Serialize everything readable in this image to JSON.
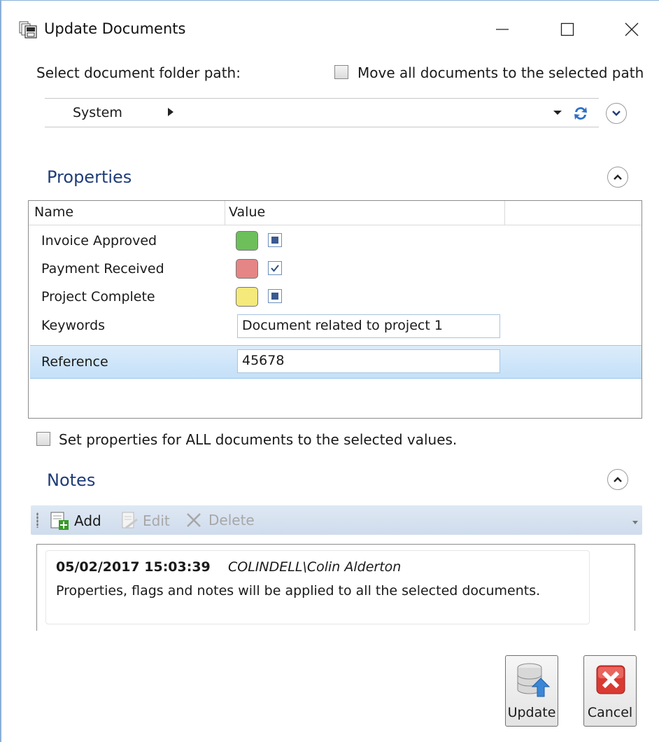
{
  "window": {
    "title": "Update Documents",
    "icons": [
      "document-stack-icon",
      "minimize-icon",
      "maximize-icon",
      "close-icon"
    ]
  },
  "folder": {
    "label": "Select document folder path:",
    "move_all_label": "Move all documents to the selected path",
    "move_all_checked": false,
    "path_segment": "System"
  },
  "properties": {
    "header": "Properties",
    "columns": [
      "Name",
      "Value"
    ],
    "rows": [
      {
        "name": "Invoice Approved",
        "type": "flag",
        "color": "#6cbf5a",
        "state": "indeterminate"
      },
      {
        "name": "Payment Received",
        "type": "flag",
        "color": "#e58585",
        "state": "checked"
      },
      {
        "name": "Project Complete",
        "type": "flag",
        "color": "#f4e97a",
        "state": "indeterminate"
      },
      {
        "name": "Keywords",
        "type": "text",
        "value": "Document related to project 1"
      },
      {
        "name": "Reference",
        "type": "text",
        "value": "45678",
        "selected": true
      }
    ],
    "set_all_label": "Set properties for ALL documents to the selected values.",
    "set_all_checked": false
  },
  "notes": {
    "header": "Notes",
    "toolbar": {
      "add_label": "Add",
      "edit_label": "Edit",
      "delete_label": "Delete"
    },
    "items": [
      {
        "date": "05/02/2017 15:03:39",
        "author": "COLINDELL\\Colin Alderton",
        "text": "Properties, flags and notes will be applied to all the selected documents."
      }
    ]
  },
  "buttons": {
    "update_label": "Update",
    "cancel_label": "Cancel"
  },
  "colors": {
    "heading": "#1f3c78",
    "selection": "#c4e0f8",
    "toolbar": "#d6e1ef"
  }
}
